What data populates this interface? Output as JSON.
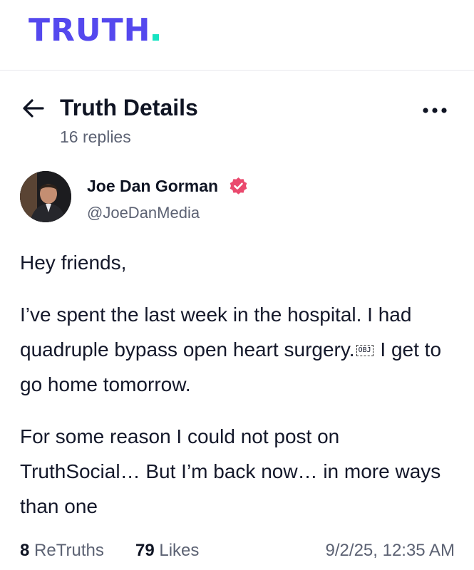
{
  "app": {
    "logo_text": "TRUTH",
    "brand_color": "#5448ee",
    "accent_color": "#17e3c2"
  },
  "header": {
    "back_icon": "arrow-left-icon",
    "title": "Truth Details",
    "subtitle": "16 replies",
    "menu_icon": "more-horizontal-icon"
  },
  "post": {
    "author": {
      "name": "Joe Dan Gorman",
      "handle": "@JoeDanMedia",
      "verified_icon": "verified-badge-icon",
      "verified_color": "#ea4a6e"
    },
    "paragraphs": [
      "Hey friends,",
      "I’ve spent the last week in the hospital. I had quadruple bypass open heart surgery.",
      "I get to go home tomorrow.",
      "For some reason I could not post on TruthSocial… But I’m back now… in more ways than one"
    ],
    "object_glyph": "OBJ",
    "stats": {
      "retruths_count": "8",
      "retruths_label": "ReTruths",
      "likes_count": "79",
      "likes_label": "Likes"
    },
    "timestamp": "9/2/25, 12:35 AM"
  }
}
